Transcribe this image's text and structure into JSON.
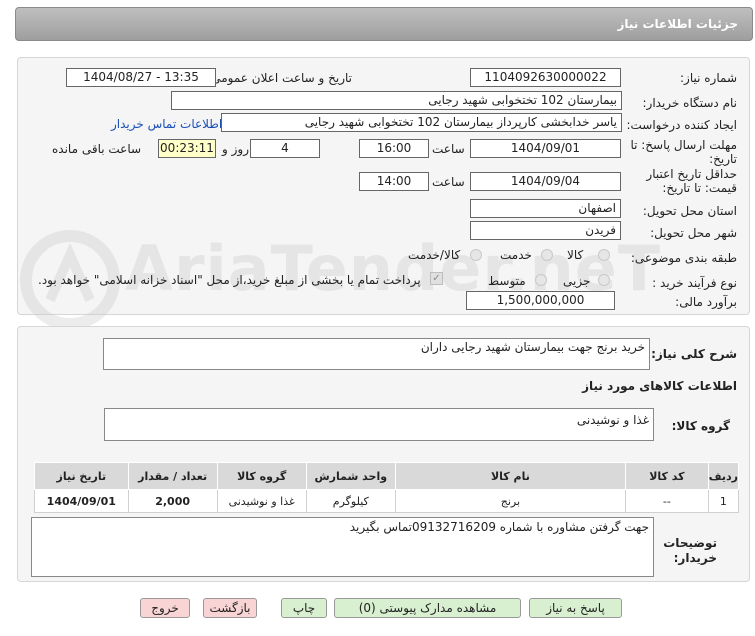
{
  "header": {
    "title": "جزئیات اطلاعات نیاز"
  },
  "watermark": "AriaTender.neT",
  "form": {
    "need_number_label": "شماره نیاز:",
    "need_number": "1104092630000022",
    "announce_label": "تاریخ و ساعت اعلان عمومی:",
    "announce_value": "1404/08/27 - 13:35",
    "buyer_org_label": "نام دستگاه خریدار:",
    "buyer_org": "بیمارستان 102 تختخوابی شهید رجایی",
    "creator_label": "ایجاد کننده درخواست:",
    "creator": "یاسر خدابخشی کارپرداز بیمارستان 102 تختخوابی شهید رجایی",
    "contact_link": "اطلاعات تماس خریدار",
    "deadline_label_1": "مهلت ارسال پاسخ: تا",
    "deadline_label_2": "تاریخ:",
    "deadline_date": "1404/09/01",
    "time_label": "ساعت",
    "deadline_time": "16:00",
    "days_value": "4",
    "days_label": "روز و",
    "remaining_time": "00:23:11",
    "remaining_label": "ساعت باقی مانده",
    "validity_label_1": "حداقل تاریخ اعتبار",
    "validity_label_2": "قیمت: تا تاریخ:",
    "validity_date": "1404/09/04",
    "validity_time": "14:00",
    "province_label": "استان محل تحویل:",
    "province": "اصفهان",
    "city_label": "شهر محل تحویل:",
    "city": "فریدن",
    "category_label": "طبقه بندی موضوعی:",
    "category_options": [
      "کالا",
      "خدمت",
      "کالا/خدمت"
    ],
    "purchase_type_label": "نوع فرآیند خرید :",
    "purchase_options": [
      "جزیی",
      "متوسط"
    ],
    "payment_note": "پرداخت تمام یا بخشی از مبلغ خرید،از محل \"اسناد خزانه اسلامی\" خواهد بود.",
    "estimate_label": "برآورد مالی:",
    "estimate": "1,500,000,000"
  },
  "details": {
    "description_label": "شرح کلی نیاز:",
    "description": "خرید برنج جهت بیمارستان شهید رجایی داران",
    "goods_info_title": "اطلاعات کالاهای مورد نیاز",
    "goods_group_label": "گروه کالا:",
    "goods_group": "غذا و نوشیدنی",
    "table": {
      "headers": [
        "ردیف",
        "کد کالا",
        "نام کالا",
        "واحد شمارش",
        "گروه کالا",
        "تعداد / مقدار",
        "تاریخ نیاز"
      ],
      "rows": [
        [
          "1",
          "--",
          "برنج",
          "کیلوگرم",
          "غذا و نوشیدنی",
          "2,000",
          "1404/09/01"
        ]
      ]
    },
    "buyer_notes_label_1": "توضیحات",
    "buyer_notes_label_2": "خریدار:",
    "buyer_notes": "جهت گرفتن مشاوره با شماره 09132716209تماس بگیرید"
  },
  "buttons": {
    "respond": "پاسخ به نیاز",
    "attachments": "مشاهده مدارک پیوستی (0)",
    "print": "چاپ",
    "back": "بازگشت",
    "exit": "خروج"
  },
  "colors": {
    "link": "#1a4fb5",
    "button_green": "#d8f0d0",
    "button_red": "#f8d4d4",
    "remaining_bg": "#ffffc8"
  }
}
